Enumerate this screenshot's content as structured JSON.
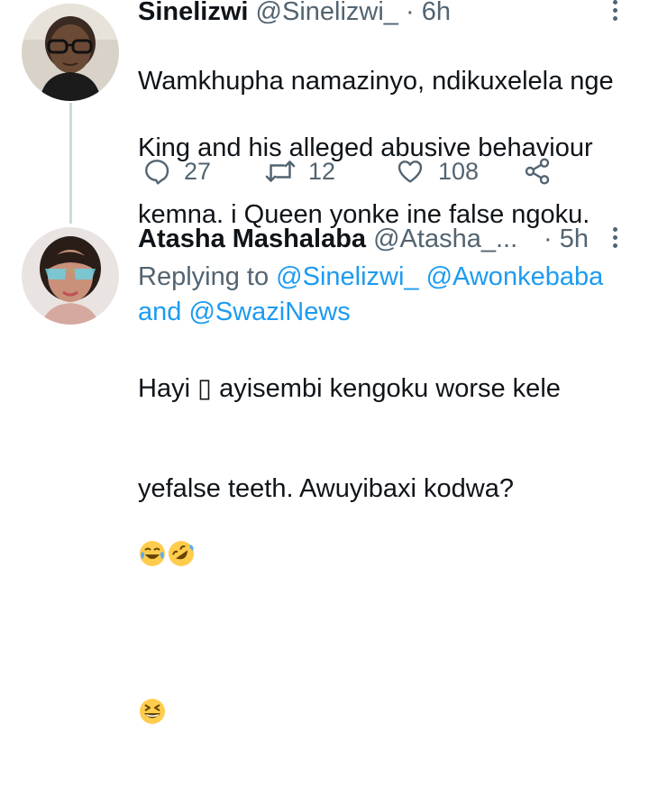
{
  "tweet1": {
    "display_name": "Sinelizwi",
    "handle": "@Sinelizwi_",
    "separator": "·",
    "time": "6h",
    "text_line1": "Wamkhupha namazinyo, ndikuxelela nge",
    "text_line2": "King and his alleged abusive behaviour",
    "text_line3": "kemna. i Queen yonke ine false ngoku.",
    "replies": "27",
    "retweets": "12",
    "likes": "108"
  },
  "tweet2": {
    "display_name": "Atasha Mashalaba",
    "handle": "@Atasha_...",
    "separator": "·",
    "time": "5h",
    "replying_prefix": "Replying to",
    "mention1": "@Sinelizwi_",
    "mention2": "@Awonkebaba",
    "replying_and": "and",
    "mention3": "@SwaziNews",
    "text_line1": "Hayi ▯ ayisembi kengoku worse kele",
    "text_line2": "yefalse teeth. Awuyibaxi kodwa?",
    "emojis_line2": [
      "face-with-tears-of-joy",
      "rolling-on-floor-laughing"
    ],
    "emojis_line3": [
      "grinning-squinting-face"
    ]
  },
  "colors": {
    "text": "#0f1419",
    "secondary": "#536471",
    "link": "#1d9bf0",
    "thread_line": "#cfd9de",
    "emoji_yellow": "#ffcc4d"
  },
  "icons": [
    "reply-icon",
    "retweet-icon",
    "like-icon",
    "share-icon",
    "more-options-icon"
  ]
}
